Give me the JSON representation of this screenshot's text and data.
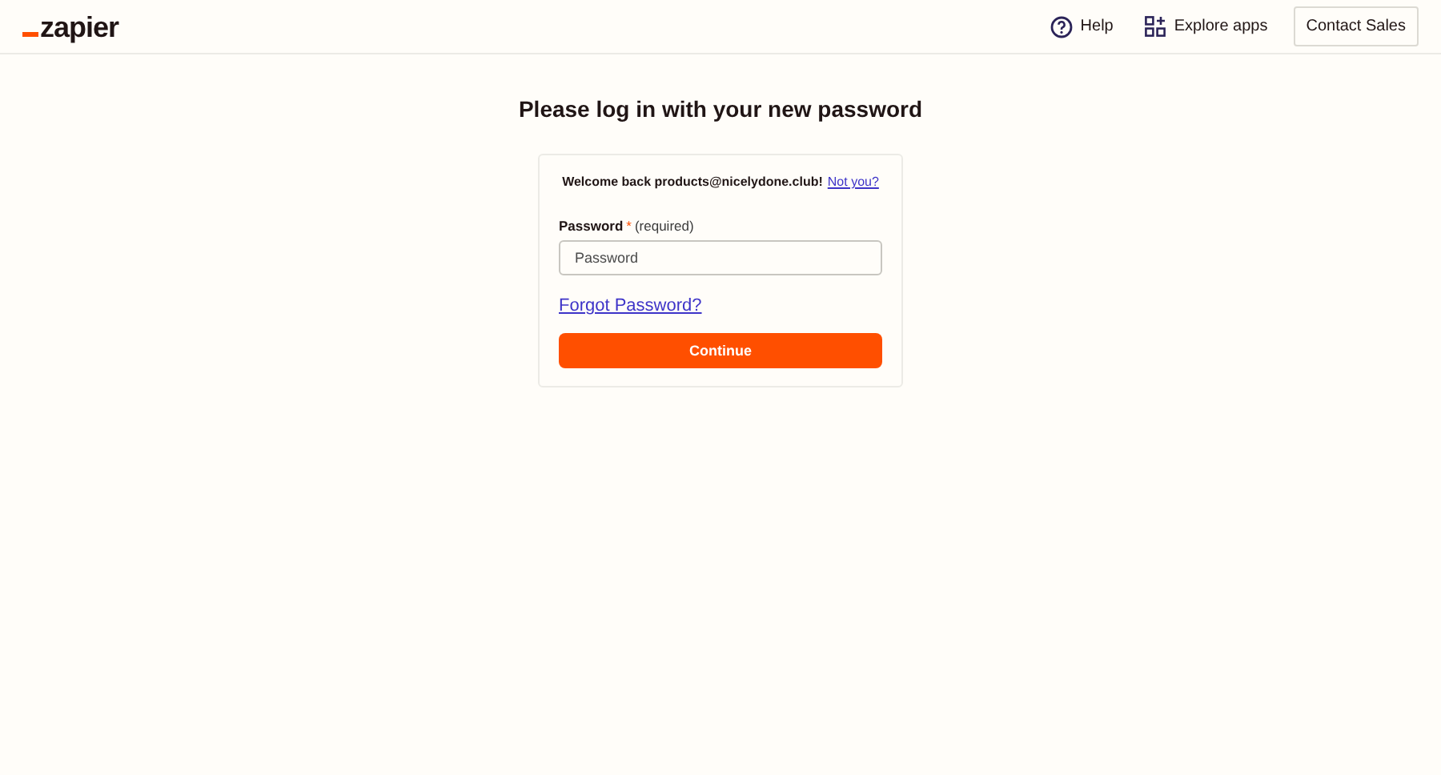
{
  "header": {
    "logo": "zapier",
    "nav": [
      {
        "kind": "help",
        "label": "Help"
      },
      {
        "kind": "apps",
        "label": "Explore apps"
      }
    ],
    "contact_button": "Contact Sales"
  },
  "title": "Please log in with your new password",
  "card": {
    "welcome": "Welcome back products@nicelydone.club!",
    "not_you_link": "Not you?",
    "password": {
      "label": "Password",
      "required_mark": "*",
      "required_note": "(required)",
      "placeholder": "Password"
    },
    "forgot_link": "Forgot Password?",
    "submit": "Continue"
  }
}
